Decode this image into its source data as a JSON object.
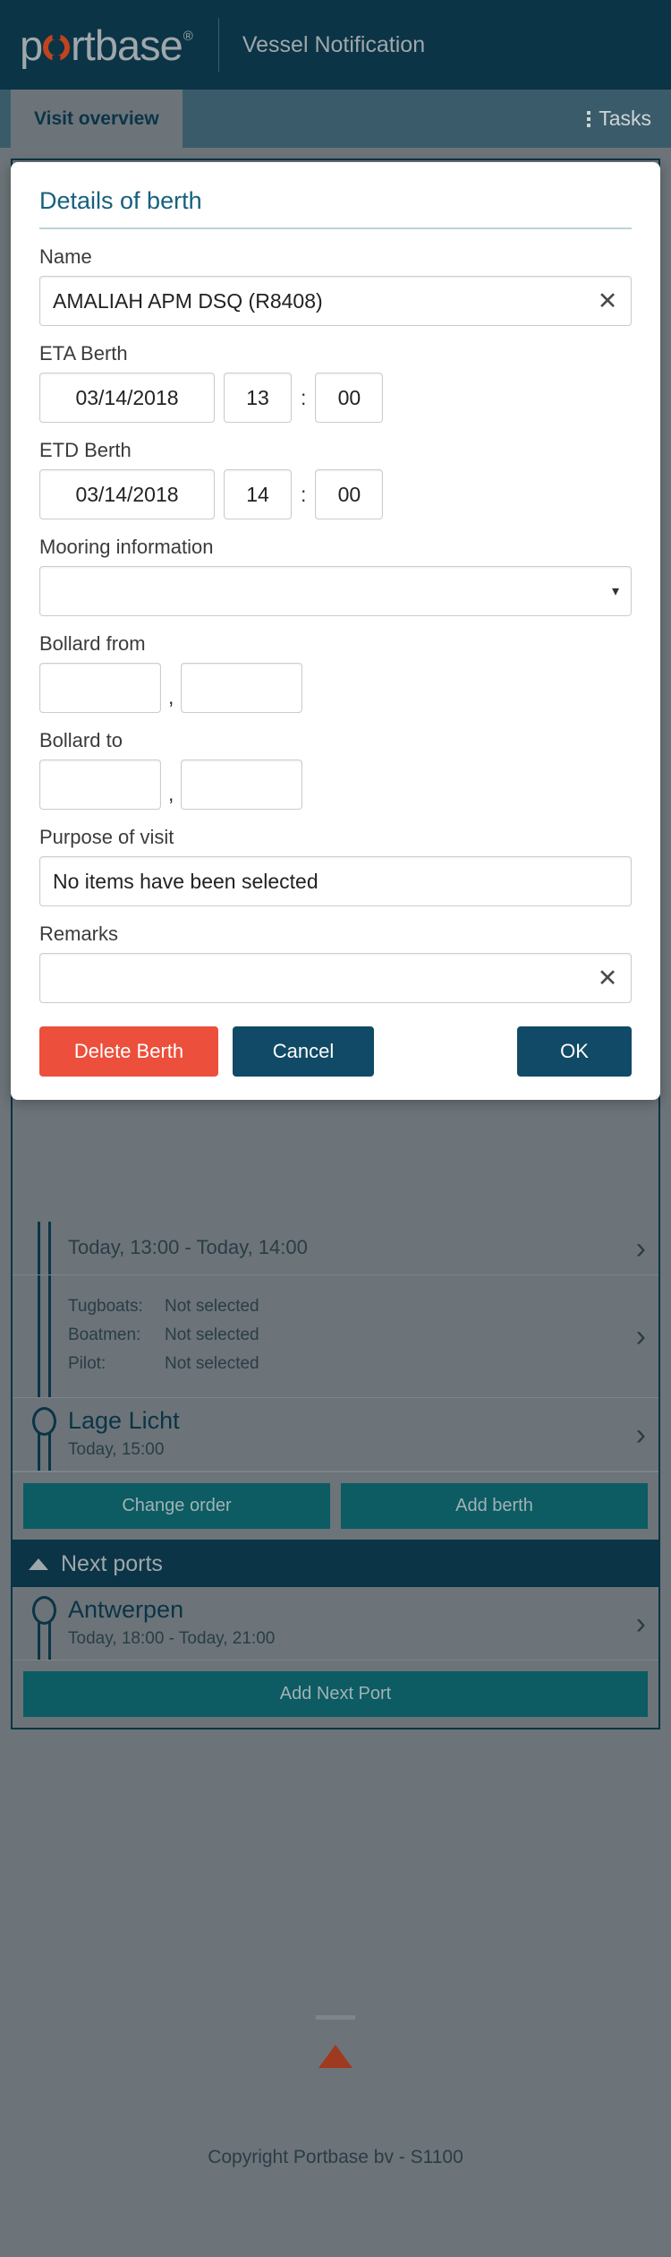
{
  "header": {
    "logo_text_pre": "p",
    "logo_icon": "o-ring-icon",
    "logo_text_post": "rtbase",
    "logo_reg": "®",
    "app_title": "Vessel Notification"
  },
  "tabs": {
    "active_tab": "Visit overview",
    "tasks_label": "Tasks",
    "tasks_icon": "kebab-menu-icon"
  },
  "modal": {
    "title": "Details of berth",
    "fields": {
      "name_label": "Name",
      "name_value": "AMALIAH APM DSQ (R8408)",
      "name_clear_icon": "✕",
      "eta_label": "ETA Berth",
      "eta_date": "03/14/2018",
      "eta_hour": "13",
      "eta_minute": "00",
      "etd_label": "ETD Berth",
      "etd_date": "03/14/2018",
      "etd_hour": "14",
      "etd_minute": "00",
      "time_separator": ":",
      "mooring_label": "Mooring information",
      "mooring_value": "",
      "mooring_caret": "▾",
      "bollard_from_label": "Bollard from",
      "bollard_from_a": "",
      "bollard_from_b": "",
      "bollard_to_label": "Bollard to",
      "bollard_to_a": "",
      "bollard_to_b": "",
      "bollard_separator": ",",
      "purpose_label": "Purpose of visit",
      "purpose_value": "No items have been selected",
      "remarks_label": "Remarks",
      "remarks_value": "",
      "remarks_clear_icon": "✕"
    },
    "buttons": {
      "delete": "Delete Berth",
      "cancel": "Cancel",
      "ok": "OK"
    }
  },
  "visit": {
    "berth_time_range": "Today, 13:00 - Today, 14:00",
    "services": [
      {
        "key": "Tugboats:",
        "value": "Not selected"
      },
      {
        "key": "Boatmen:",
        "value": "Not selected"
      },
      {
        "key": "Pilot:",
        "value": "Not selected"
      }
    ],
    "lage_licht_title": "Lage Licht",
    "lage_licht_time": "Today, 15:00",
    "change_order_label": "Change order",
    "add_berth_label": "Add berth",
    "chevron_icon": "›"
  },
  "next_ports": {
    "section_title": "Next ports",
    "collapse_icon": "caret-up-icon",
    "port_name": "Antwerpen",
    "port_time": "Today, 18:00 - Today, 21:00",
    "add_next_port_label": "Add Next Port",
    "chevron_icon": "›"
  },
  "footer": {
    "scroll_top_icon": "up-triangle-icon",
    "copyright": "Copyright Portbase bv - S1100"
  },
  "colors": {
    "brand_dark": "#0b3446",
    "brand_teal": "#0d5b63",
    "accent_orange": "#c0441f",
    "danger": "#ec4f3c",
    "primary_button": "#114a66",
    "dim_overlay": "#6c7479"
  }
}
